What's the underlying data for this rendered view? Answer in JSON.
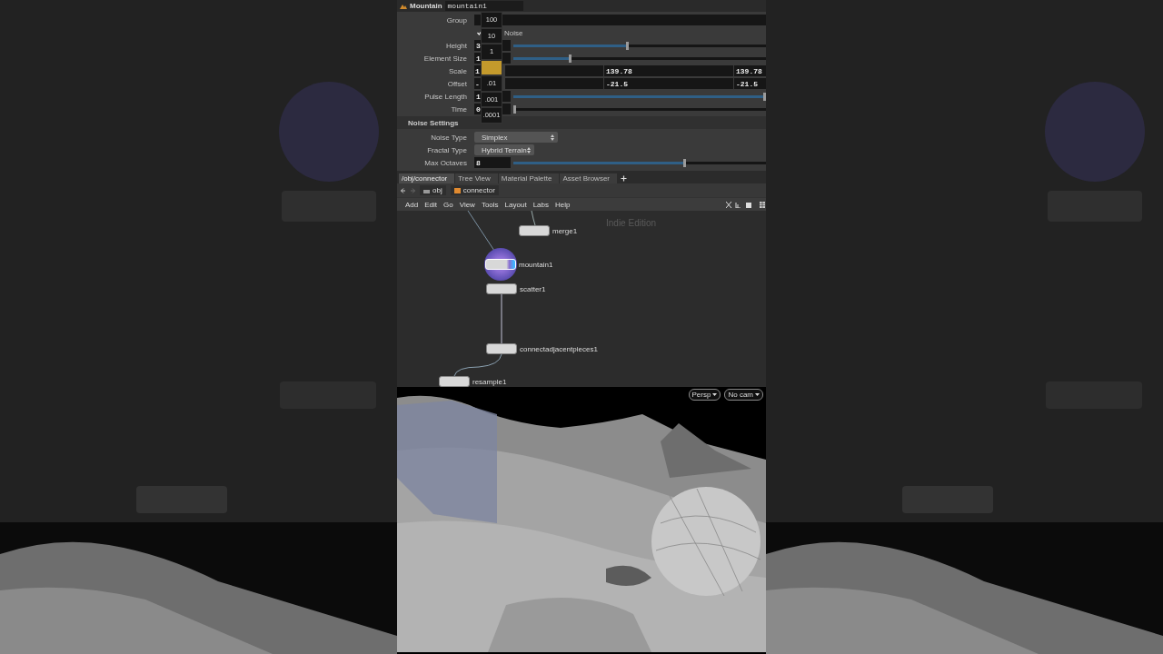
{
  "header": {
    "type_label": "Mountain",
    "name": "mountain1"
  },
  "parameters": [
    {
      "kind": "field",
      "label": "Group"
    },
    {
      "kind": "checkbox",
      "label": "Noise",
      "checked": true
    },
    {
      "kind": "slider",
      "label": "Height",
      "value": "3",
      "level": 0.45
    },
    {
      "kind": "slider",
      "label": "Element Size",
      "value": "1",
      "level": 0.22
    },
    {
      "kind": "vector",
      "label": "Scale",
      "values": [
        "1",
        "139.78",
        "139.78"
      ]
    },
    {
      "kind": "vector",
      "label": "Offset",
      "values": [
        "-",
        "-21.5",
        "-21.5"
      ]
    },
    {
      "kind": "slider",
      "label": "Pulse Length",
      "value": "1",
      "level": 1
    },
    {
      "kind": "slider",
      "label": "Time",
      "value": "0",
      "level": 0
    },
    {
      "kind": "section",
      "label": "Noise Settings"
    },
    {
      "kind": "menu",
      "label": "Noise Type",
      "value": "Simplex"
    },
    {
      "kind": "menu",
      "label": "Fractal Type",
      "value": "Hybrid Terrain"
    },
    {
      "kind": "slider",
      "label": "Max Octaves",
      "value": "8",
      "level": 0.68
    }
  ],
  "value_ladder": [
    {
      "label": "100",
      "selected": false
    },
    {
      "label": "10",
      "selected": false
    },
    {
      "label": "1",
      "selected": false
    },
    {
      "selected": true
    },
    {
      "label": ".01",
      "selected": false
    },
    {
      "label": ".001",
      "selected": false
    },
    {
      "label": ".0001",
      "selected": false
    }
  ],
  "tabs": [
    {
      "label": "/obj/connector",
      "selected": true
    },
    {
      "label": "Tree View",
      "selected": false
    },
    {
      "label": "Material Palette",
      "selected": false
    },
    {
      "label": "Asset Browser",
      "selected": false
    }
  ],
  "path": [
    "obj",
    "connector"
  ],
  "menu": [
    "Add",
    "Edit",
    "Go",
    "View",
    "Tools",
    "Layout",
    "Labs",
    "Help"
  ],
  "network": {
    "edition": "Indie Edition",
    "nodes": [
      {
        "label": "merge1",
        "selected": false
      },
      {
        "label": "mountain1",
        "selected": true
      },
      {
        "label": "scatter1",
        "selected": false
      },
      {
        "label": "connectadjacentpieces1",
        "selected": false
      },
      {
        "label": "resample1",
        "selected": false
      }
    ]
  },
  "viewport": {
    "buttons": [
      "Persp",
      "No cam"
    ]
  }
}
